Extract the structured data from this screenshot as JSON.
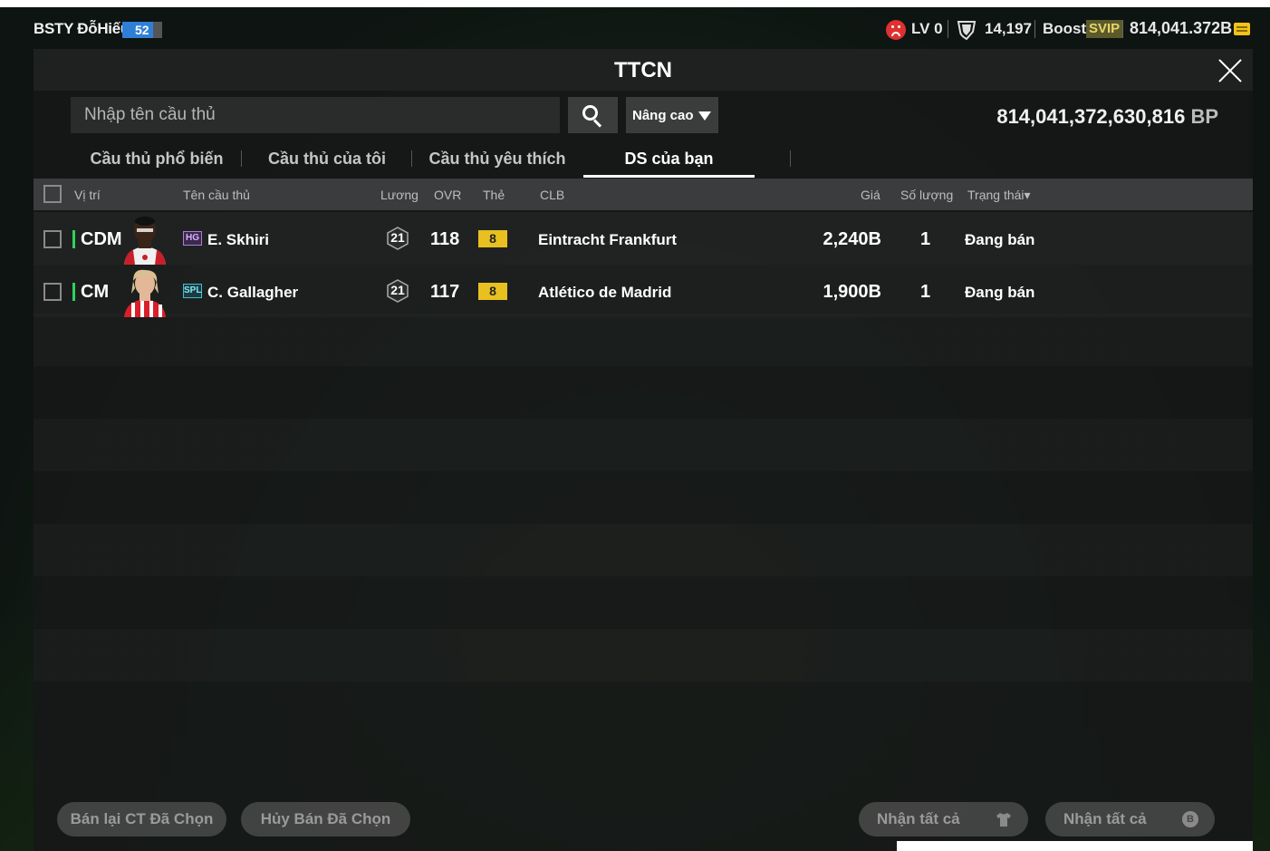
{
  "statusbar": {
    "username": "BSTY ĐỗHiếu",
    "level": "52",
    "lv_text": "LV 0",
    "coins": "14,197",
    "boost_label": "Boost",
    "svip_label": "SVIP",
    "bp_short": "814,041.372B"
  },
  "panel": {
    "title": "TTCN",
    "search_placeholder": "Nhập tên cầu thủ",
    "advanced_label": "Nâng cao",
    "bp_balance": "814,041,372,630,816",
    "bp_unit": "BP"
  },
  "tabs": [
    {
      "label": "Cầu thủ phổ biến"
    },
    {
      "label": "Cầu thủ của tôi"
    },
    {
      "label": "Cầu thủ yêu thích"
    },
    {
      "label": "DS của bạn"
    }
  ],
  "table": {
    "headers": {
      "position": "Vị trí",
      "name": "Tên cầu thủ",
      "salary": "Lương",
      "ovr": "OVR",
      "card": "Thẻ",
      "club": "CLB",
      "price": "Giá",
      "qty": "Số lượng",
      "status": "Trạng thái▾"
    },
    "rows": [
      {
        "position": "CDM",
        "season": "HG",
        "name": "E. Skhiri",
        "salary": "21",
        "ovr": "118",
        "grade": "8",
        "club": "Eintracht Frankfurt",
        "price": "2,240B",
        "qty": "1",
        "status": "Đang bán"
      },
      {
        "position": "CM",
        "season": "SPL",
        "name": "C. Gallagher",
        "salary": "21",
        "ovr": "117",
        "grade": "8",
        "club": "Atlético de Madrid",
        "price": "1,900B",
        "qty": "1",
        "status": "Đang bán"
      }
    ]
  },
  "footer": {
    "resell_label": "Bán lại CT Đã Chọn",
    "cancel_label": "Hủy Bán Đã Chọn",
    "claim_all_1": "Nhận tất cả",
    "claim_all_2": "Nhận tất cả",
    "coin_glyph": "B"
  },
  "colors": {
    "accent_green": "#2fd35a",
    "grade_yellow": "#e8c020",
    "level_blue": "#2f7fd6"
  }
}
